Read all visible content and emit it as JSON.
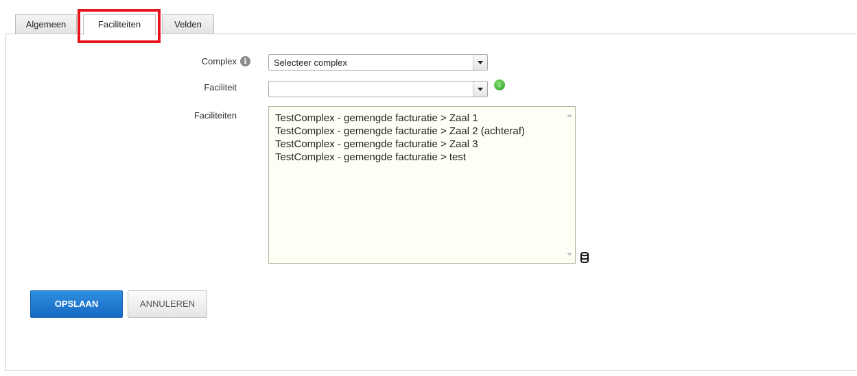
{
  "tabs": [
    {
      "label": "Algemeen"
    },
    {
      "label": "Faciliteiten",
      "active": true
    },
    {
      "label": "Velden"
    }
  ],
  "form": {
    "complex_label": "Complex",
    "complex_value": "Selecteer complex",
    "faciliteit_label": "Faciliteit",
    "faciliteit_value": "",
    "faciliteiten_label": "Faciliteiten",
    "faciliteiten_items": [
      "TestComplex - gemengde facturatie > Zaal 1",
      "TestComplex - gemengde facturatie > Zaal 2 (achteraf)",
      "TestComplex - gemengde facturatie > Zaal 3",
      "TestComplex - gemengde facturatie > test"
    ]
  },
  "icons": {
    "info": "info-icon",
    "add": "add-icon",
    "database": "database-icon"
  },
  "buttons": {
    "save": "OPSLAAN",
    "cancel": "ANNULEREN"
  },
  "colors": {
    "primary": "#1a73d0",
    "highlight": "#e8131b",
    "listbox_bg": "#fefef4",
    "add_icon": "#3aa52d"
  }
}
